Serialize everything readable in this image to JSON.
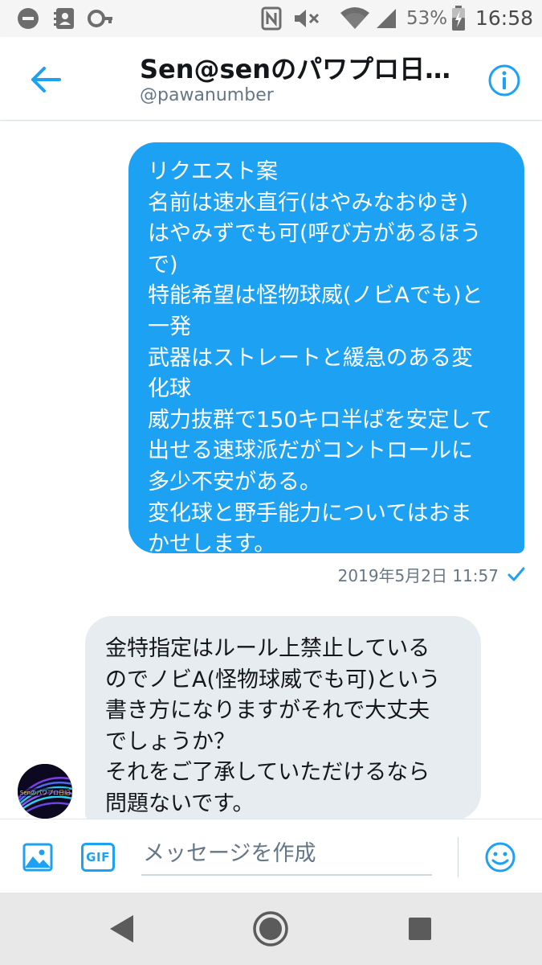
{
  "status_bar": {
    "battery_percent": "53%",
    "clock": "16:58",
    "left_icons": [
      "minus-circle-icon",
      "contacts-icon",
      "key-icon"
    ],
    "right_icons": [
      "nfc-icon",
      "mute-icon",
      "wifi-icon",
      "signal-icon",
      "battery-charging-icon"
    ]
  },
  "header": {
    "title": "Sen@senのパワプロ日…",
    "handle": "@pawanumber",
    "back_icon": "arrow-left-icon",
    "info_icon": "info-icon"
  },
  "messages": {
    "sent": {
      "lines": [
        "リクエスト案",
        "名前は速水直行(はやみなおゆき)",
        "はやみずでも可(呼び方があるほう",
        "で)",
        "特能希望は怪物球威(ノビAでも)と",
        "一発",
        "武器はストレートと緩急のある変",
        "化球",
        "威力抜群で150キロ半ばを安定して",
        "出せる速球派だがコントロールに",
        "多少不安がある。",
        "変化球と野手能力についてはおま",
        "かせします。"
      ],
      "timestamp": "2019年5月2日 11:57",
      "status_icon": "check-icon"
    },
    "received": {
      "lines": [
        "金特指定はルール上禁止している",
        "のでノビA(怪物球威でも可)という",
        "書き方になりますがそれで大丈夫",
        "でしょうか？",
        "それをご了承していただけるなら",
        "問題ないです。"
      ],
      "avatar_text": "Senのパワプロ日記"
    }
  },
  "composer": {
    "placeholder": "メッセージを作成",
    "gif_label": "GIF",
    "media_icon": "image-icon",
    "emoji_icon": "emoji-icon"
  },
  "nav_bar": {
    "icons": [
      "back-triangle-icon",
      "home-circle-icon",
      "recents-square-icon"
    ]
  },
  "colors": {
    "accent": "#1da1f2",
    "sent_bubble": "#1da1f2",
    "received_bubble": "#e6ecf0",
    "secondary_text": "#657786"
  }
}
